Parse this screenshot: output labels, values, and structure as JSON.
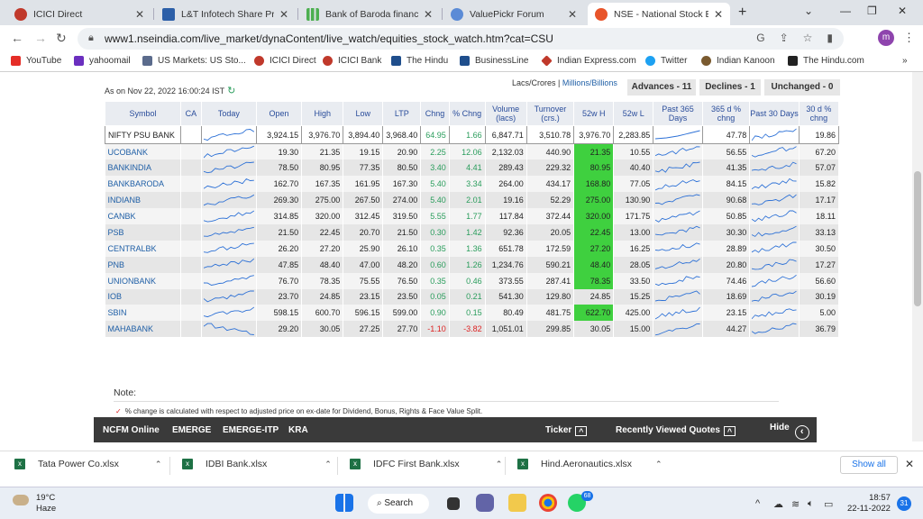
{
  "browser": {
    "tabs": [
      {
        "title": "ICICI Direct",
        "color": "#c0392b"
      },
      {
        "title": "L&T Infotech Share Price...",
        "color": "#2c5fa8"
      },
      {
        "title": "Bank of Baroda financial r...",
        "color": "#4caf50"
      },
      {
        "title": "ValuePickr Forum",
        "color": "#5b8bd6"
      },
      {
        "title": "NSE - National Stock Exch...",
        "color": "#e8542a"
      }
    ],
    "url": "www1.nseindia.com/live_market/dynaContent/live_watch/equities_stock_watch.htm?cat=CSU",
    "profile_initial": "m",
    "bookmarks": [
      {
        "label": "YouTube",
        "color": "#e52d27"
      },
      {
        "label": "yahoomail",
        "color": "#6b2fbf"
      },
      {
        "label": "US Markets: US Sto...",
        "color": "#5b6b8c"
      },
      {
        "label": "ICICI Direct",
        "color": "#c0392b"
      },
      {
        "label": "ICICI Bank",
        "color": "#c0392b"
      },
      {
        "label": "The Hindu",
        "color": "#1f4e8c"
      },
      {
        "label": "BusinessLine",
        "color": "#1f4e8c"
      },
      {
        "label": "Indian Express.com",
        "color": "#c0392b"
      },
      {
        "label": "Twitter",
        "color": "#1da1f2"
      },
      {
        "label": "Indian Kanoon",
        "color": "#7a5a2f"
      },
      {
        "label": "The Hindu.com",
        "color": "#222222"
      }
    ]
  },
  "page": {
    "as_of": "As on Nov 22, 2022 16:00:24 IST",
    "units_prefix": "Lacs/Crores",
    "units_sep": " | ",
    "units_alt": "Millions/Billions",
    "advances": "Advances - 11",
    "declines": "Declines - 1",
    "unchanged": "Unchanged - 0",
    "headers": [
      "Symbol",
      "CA",
      "Today",
      "Open",
      "High",
      "Low",
      "LTP",
      "Chng",
      "% Chng",
      "Volume (lacs)",
      "Turnover (crs.)",
      "52w H",
      "52w L",
      "Past 365 Days",
      "365 d % chng",
      "Past 30 Days",
      "30 d % chng"
    ],
    "index_row": {
      "symbol": "NIFTY PSU BANK",
      "open": "3,924.15",
      "high": "3,976.70",
      "low": "3,894.40",
      "ltp": "3,968.40",
      "chng": "64.95",
      "pchng": "1.66",
      "volume": "6,847.71",
      "turnover": "3,510.78",
      "w52h": "3,976.70",
      "w52l": "2,283.85",
      "d365": "47.78",
      "d30": "19.86"
    },
    "rows": [
      {
        "symbol": "UCOBANK",
        "open": "19.30",
        "high": "21.35",
        "low": "19.15",
        "ltp": "20.90",
        "chng": "2.25",
        "pchng": "12.06",
        "volume": "2,132.03",
        "turnover": "440.90",
        "w52h": "21.35",
        "w52l": "10.55",
        "d365": "56.55",
        "d30": "67.20",
        "at_high": true
      },
      {
        "symbol": "BANKINDIA",
        "open": "78.50",
        "high": "80.95",
        "low": "77.35",
        "ltp": "80.50",
        "chng": "3.40",
        "pchng": "4.41",
        "volume": "289.43",
        "turnover": "229.32",
        "w52h": "80.95",
        "w52l": "40.40",
        "d365": "41.35",
        "d30": "57.07",
        "at_high": true
      },
      {
        "symbol": "BANKBARODA",
        "open": "162.70",
        "high": "167.35",
        "low": "161.95",
        "ltp": "167.30",
        "chng": "5.40",
        "pchng": "3.34",
        "volume": "264.00",
        "turnover": "434.17",
        "w52h": "168.80",
        "w52l": "77.05",
        "d365": "84.15",
        "d30": "15.82",
        "at_high": true
      },
      {
        "symbol": "INDIANB",
        "open": "269.30",
        "high": "275.00",
        "low": "267.50",
        "ltp": "274.00",
        "chng": "5.40",
        "pchng": "2.01",
        "volume": "19.16",
        "turnover": "52.29",
        "w52h": "275.00",
        "w52l": "130.90",
        "d365": "90.68",
        "d30": "17.17",
        "at_high": true
      },
      {
        "symbol": "CANBK",
        "open": "314.85",
        "high": "320.00",
        "low": "312.45",
        "ltp": "319.50",
        "chng": "5.55",
        "pchng": "1.77",
        "volume": "117.84",
        "turnover": "372.44",
        "w52h": "320.00",
        "w52l": "171.75",
        "d365": "50.85",
        "d30": "18.11",
        "at_high": true
      },
      {
        "symbol": "PSB",
        "open": "21.50",
        "high": "22.45",
        "low": "20.70",
        "ltp": "21.50",
        "chng": "0.30",
        "pchng": "1.42",
        "volume": "92.36",
        "turnover": "20.05",
        "w52h": "22.45",
        "w52l": "13.00",
        "d365": "30.30",
        "d30": "33.13",
        "at_high": true
      },
      {
        "symbol": "CENTRALBK",
        "open": "26.20",
        "high": "27.20",
        "low": "25.90",
        "ltp": "26.10",
        "chng": "0.35",
        "pchng": "1.36",
        "volume": "651.78",
        "turnover": "172.59",
        "w52h": "27.20",
        "w52l": "16.25",
        "d365": "28.89",
        "d30": "30.50",
        "at_high": true
      },
      {
        "symbol": "PNB",
        "open": "47.85",
        "high": "48.40",
        "low": "47.00",
        "ltp": "48.20",
        "chng": "0.60",
        "pchng": "1.26",
        "volume": "1,234.76",
        "turnover": "590.21",
        "w52h": "48.40",
        "w52l": "28.05",
        "d365": "20.80",
        "d30": "17.27",
        "at_high": true
      },
      {
        "symbol": "UNIONBANK",
        "open": "76.70",
        "high": "78.35",
        "low": "75.55",
        "ltp": "76.50",
        "chng": "0.35",
        "pchng": "0.46",
        "volume": "373.55",
        "turnover": "287.41",
        "w52h": "78.35",
        "w52l": "33.50",
        "d365": "74.46",
        "d30": "56.60",
        "at_high": true
      },
      {
        "symbol": "IOB",
        "open": "23.70",
        "high": "24.85",
        "low": "23.15",
        "ltp": "23.50",
        "chng": "0.05",
        "pchng": "0.21",
        "volume": "541.30",
        "turnover": "129.80",
        "w52h": "24.85",
        "w52l": "15.25",
        "d365": "18.69",
        "d30": "30.19",
        "at_high": false
      },
      {
        "symbol": "SBIN",
        "open": "598.15",
        "high": "600.70",
        "low": "596.15",
        "ltp": "599.00",
        "chng": "0.90",
        "pchng": "0.15",
        "volume": "80.49",
        "turnover": "481.75",
        "w52h": "622.70",
        "w52l": "425.00",
        "d365": "23.15",
        "d30": "5.00",
        "at_high": true
      },
      {
        "symbol": "MAHABANK",
        "open": "29.20",
        "high": "30.05",
        "low": "27.25",
        "ltp": "27.70",
        "chng": "-1.10",
        "pchng": "-3.82",
        "volume": "1,051.01",
        "turnover": "299.85",
        "w52h": "30.05",
        "w52l": "15.00",
        "d365": "44.27",
        "d30": "36.79",
        "at_high": false
      }
    ],
    "note_label": "Note:",
    "footnote": "% change is calculated with respect to adjusted price on ex-date for Dividend, Bonus, Rights & Face Value Split.",
    "highlight_color": "#3fd03f"
  },
  "footer_bar": {
    "links": [
      "NCFM Online",
      "EMERGE",
      "EMERGE-ITP",
      "KRA"
    ],
    "ticker": "Ticker",
    "recent": "Recently Viewed Quotes",
    "hide": "Hide"
  },
  "downloads": {
    "files": [
      "Tata Power Co.xlsx",
      "IDBI Bank.xlsx",
      "IDFC First Bank.xlsx",
      "Hind.Aeronautics.xlsx"
    ],
    "show_all": "Show all"
  },
  "taskbar": {
    "temp": "19°C",
    "weather": "Haze",
    "search": "Search",
    "badge": "68",
    "time": "18:57",
    "date": "22-11-2022",
    "notifications": "31"
  }
}
